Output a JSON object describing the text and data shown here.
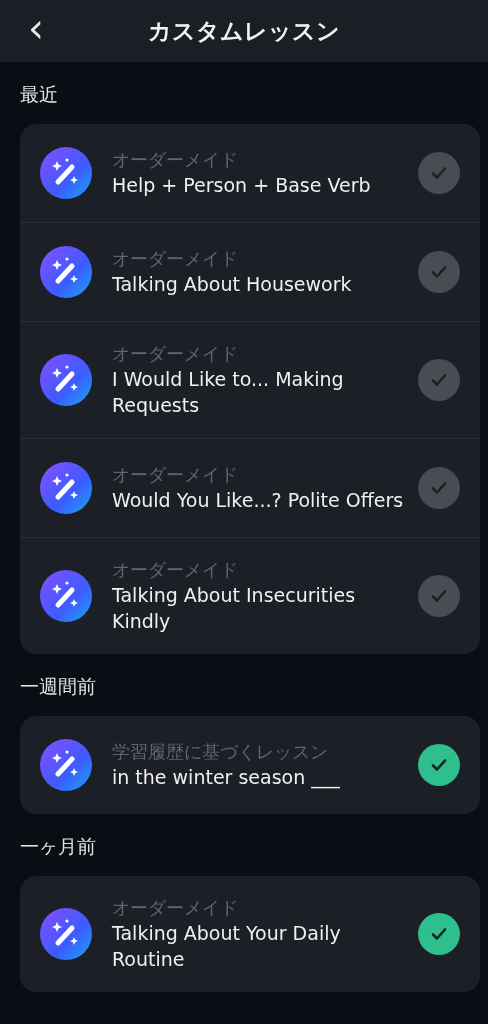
{
  "header": {
    "back": "‹",
    "title": "カスタムレッスン"
  },
  "sections": [
    {
      "label": "最近",
      "lessons": [
        {
          "type": "オーダーメイド",
          "title": "Help + Person + Base Verb",
          "completed": false
        },
        {
          "type": "オーダーメイド",
          "title": "Talking About Housework",
          "completed": false
        },
        {
          "type": "オーダーメイド",
          "title": "I Would Like to... Making Requests",
          "completed": false
        },
        {
          "type": "オーダーメイド",
          "title": "Would You Like...? Polite Offers",
          "completed": false
        },
        {
          "type": "オーダーメイド",
          "title": "Talking About Insecurities Kindly",
          "completed": false
        }
      ]
    },
    {
      "label": "一週間前",
      "lessons": [
        {
          "type": "学習履歴に基づくレッスン",
          "title": "in the winter season ___",
          "completed": true
        }
      ]
    },
    {
      "label": "一ヶ月前",
      "lessons": [
        {
          "type": "オーダーメイド",
          "title": "Talking About Your Daily Routine",
          "completed": true
        }
      ]
    }
  ]
}
